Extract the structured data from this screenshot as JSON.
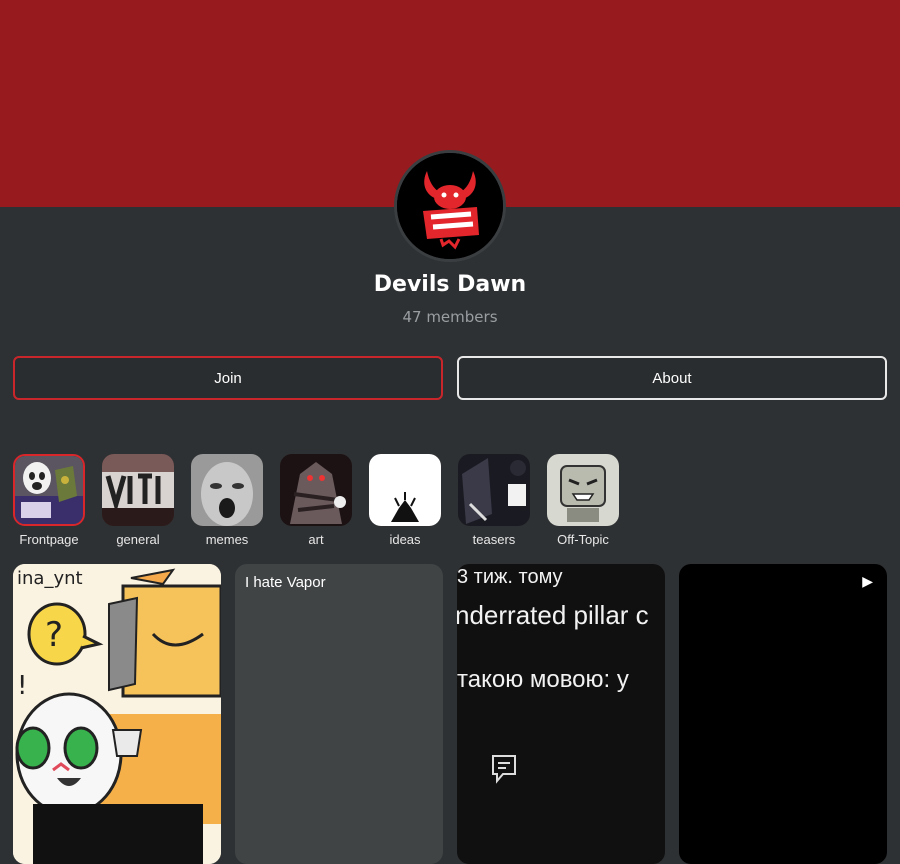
{
  "community": {
    "name": "Devils Dawn",
    "members": "47 members",
    "logo_text": "Devils Dawn"
  },
  "buttons": {
    "join": "Join",
    "about": "About"
  },
  "channels": [
    {
      "label": "Frontpage",
      "selected": true
    },
    {
      "label": "general"
    },
    {
      "label": "memes"
    },
    {
      "label": "art"
    },
    {
      "label": "ideas"
    },
    {
      "label": "teasers"
    },
    {
      "label": "Off-Topic"
    }
  ],
  "posts": [
    {
      "type": "image",
      "overlay_text": "ina_ynt"
    },
    {
      "type": "text",
      "title": "I hate Vapor"
    },
    {
      "type": "text-image",
      "lines": [
        "3 тиж. тому",
        "nderrated pillar c",
        "такою мовою: у"
      ],
      "icon": "comment-icon"
    },
    {
      "type": "video",
      "icon": "play-icon"
    }
  ],
  "colors": {
    "banner": "#971b1e",
    "background": "#2e3133",
    "join_border": "#c8262b",
    "about_border": "#e8e8e8",
    "muted_text": "#9a9ea1"
  }
}
